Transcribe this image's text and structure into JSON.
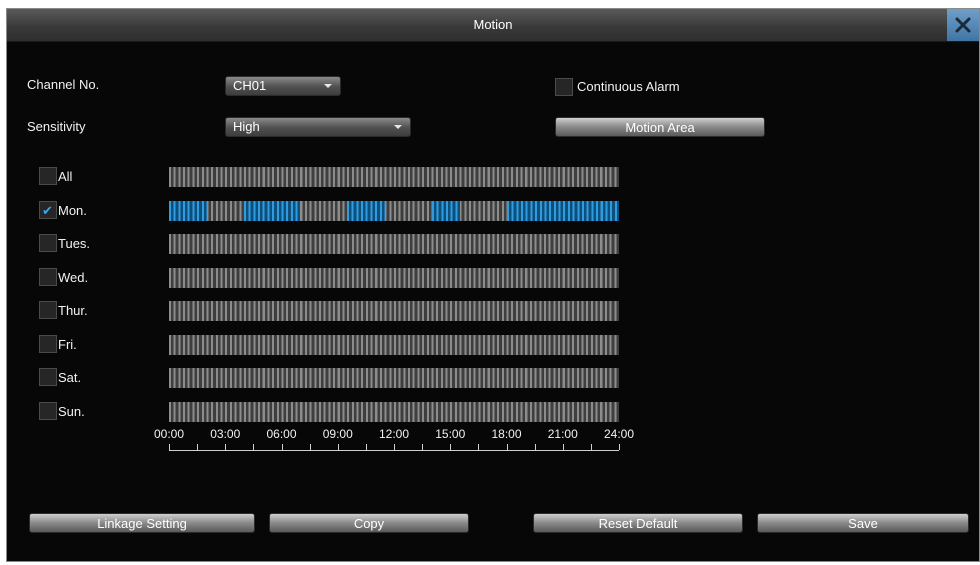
{
  "window": {
    "title": "Motion"
  },
  "form": {
    "channel_label": "Channel No.",
    "channel_value": "CH01",
    "sensitivity_label": "Sensitivity",
    "sensitivity_value": "High",
    "continuous_alarm_label": "Continuous Alarm",
    "continuous_alarm_checked": false,
    "motion_area_label": "Motion Area"
  },
  "schedule": {
    "days": [
      {
        "label": "All",
        "checked": false,
        "active_ranges": []
      },
      {
        "label": "Mon.",
        "checked": true,
        "active_ranges": [
          [
            0,
            2
          ],
          [
            4,
            7
          ],
          [
            9.5,
            11.5
          ],
          [
            14,
            15.5
          ],
          [
            18,
            24
          ]
        ]
      },
      {
        "label": "Tues.",
        "checked": false,
        "active_ranges": []
      },
      {
        "label": "Wed.",
        "checked": false,
        "active_ranges": []
      },
      {
        "label": "Thur.",
        "checked": false,
        "active_ranges": []
      },
      {
        "label": "Fri.",
        "checked": false,
        "active_ranges": []
      },
      {
        "label": "Sat.",
        "checked": false,
        "active_ranges": []
      },
      {
        "label": "Sun.",
        "checked": false,
        "active_ranges": []
      }
    ],
    "time_labels": [
      "00:00",
      "03:00",
      "06:00",
      "09:00",
      "12:00",
      "15:00",
      "18:00",
      "21:00",
      "24:00"
    ],
    "active_color": "#2f9be0"
  },
  "buttons": {
    "linkage": "Linkage Setting",
    "copy": "Copy",
    "reset": "Reset Default",
    "save": "Save"
  },
  "icons": {
    "close": "close-icon",
    "dropdown": "chevron-down-icon",
    "check": "checkmark-icon"
  }
}
